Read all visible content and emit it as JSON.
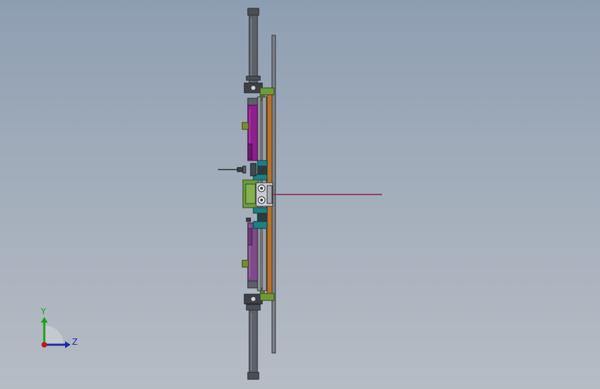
{
  "viewport": {
    "background_top": "#8e9eb2",
    "background_bottom": "#b6bcc4"
  },
  "colors": {
    "shaft": "#5c6068",
    "shaft_dark": "#3a3d43",
    "plate": "#7c8088",
    "frame_green": "#6f9a3c",
    "frame_green_dark": "#40612a",
    "orange": "#b8722a",
    "magenta": "#8e1f8c",
    "violet": "#7e4a8a",
    "teal": "#1f7f82",
    "olive": "#7a8a30",
    "rod_line": "#8b1c4b",
    "triad_y": "#1aa01a",
    "triad_z": "#1c2aa8",
    "triad_origin": "#c01818"
  },
  "triad": {
    "y_label": "Y",
    "z_label": "Z"
  }
}
